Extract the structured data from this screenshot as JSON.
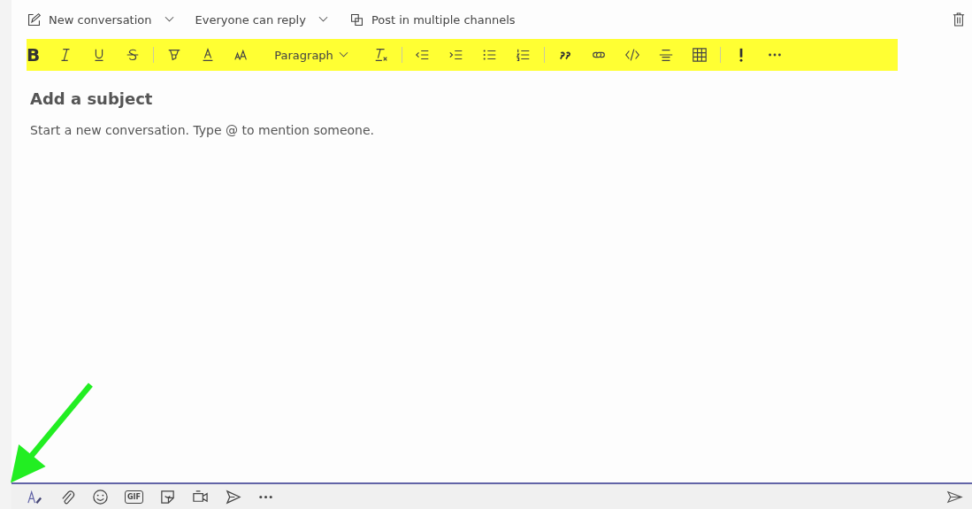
{
  "header": {
    "items": [
      {
        "kind": "compose",
        "label": "New conversation",
        "dropdown": true
      },
      {
        "kind": "none",
        "label": "Everyone can reply",
        "dropdown": true
      },
      {
        "kind": "copy",
        "label": "Post in multiple channels",
        "dropdown": false
      }
    ]
  },
  "format_toolbar": {
    "items": [
      {
        "kind": "glyph",
        "text": "B"
      },
      {
        "kind": "italic"
      },
      {
        "kind": "underline"
      },
      {
        "kind": "strike"
      },
      {
        "kind": "sep"
      },
      {
        "kind": "highlight"
      },
      {
        "kind": "fontcolor"
      },
      {
        "kind": "fontsize"
      },
      {
        "kind": "select",
        "text": "Paragraph"
      },
      {
        "kind": "clear"
      },
      {
        "kind": "sep"
      },
      {
        "kind": "outdent"
      },
      {
        "kind": "indent"
      },
      {
        "kind": "bullets"
      },
      {
        "kind": "numbers"
      },
      {
        "kind": "sep"
      },
      {
        "kind": "quote"
      },
      {
        "kind": "link"
      },
      {
        "kind": "code"
      },
      {
        "kind": "rule"
      },
      {
        "kind": "table"
      },
      {
        "kind": "sep"
      },
      {
        "kind": "important"
      },
      {
        "kind": "more"
      }
    ]
  },
  "subject": {
    "placeholder": "Add a subject"
  },
  "message": {
    "placeholder": "Start a new conversation. Type @ to mention someone."
  },
  "bottom_toolbar": {
    "items": [
      {
        "kind": "format"
      },
      {
        "kind": "attach"
      },
      {
        "kind": "emoji"
      },
      {
        "kind": "gif",
        "text": "GIF"
      },
      {
        "kind": "sticker"
      },
      {
        "kind": "meet"
      },
      {
        "kind": "praise"
      },
      {
        "kind": "more"
      }
    ]
  }
}
